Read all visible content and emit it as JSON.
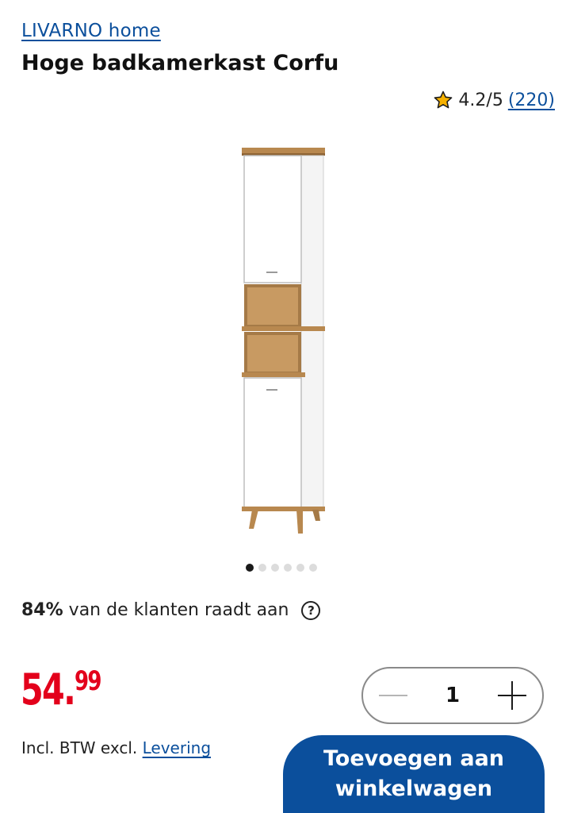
{
  "header": {
    "brand": "LIVARNO home",
    "title": "Hoge badkamerkast Corfu"
  },
  "rating": {
    "score": "4.2/5",
    "count": "(220)",
    "icon": "star-icon"
  },
  "gallery": {
    "total_images": 6,
    "active_index": 0
  },
  "recommendation": {
    "percent": "84%",
    "text": "van de klanten raadt aan",
    "help_icon": "question-circle-icon",
    "help_glyph": "?"
  },
  "price": {
    "main": "54.",
    "cents": "99",
    "color": "#e3001b"
  },
  "vat": {
    "text": "Incl. BTW excl.",
    "link": "Levering"
  },
  "quantity": {
    "value": "1",
    "decrement_icon": "minus-icon",
    "increment_icon": "plus-icon"
  },
  "cart": {
    "button_label": "Toevoegen aan winkelwagen",
    "color": "#0b4f9c"
  }
}
